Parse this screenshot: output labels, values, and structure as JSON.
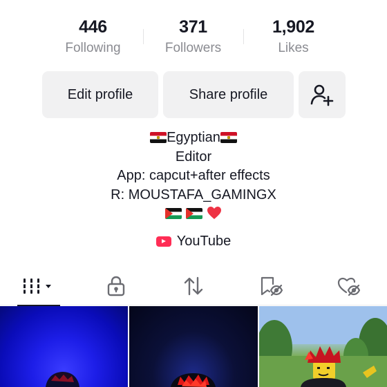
{
  "stats": [
    {
      "value": "446",
      "label": "Following"
    },
    {
      "value": "371",
      "label": "Followers"
    },
    {
      "value": "1,902",
      "label": "Likes"
    }
  ],
  "actions": {
    "edit_label": "Edit profile",
    "share_label": "Share profile",
    "add_friends_icon": "add-user-icon"
  },
  "bio": {
    "line1_text": "Egyptian",
    "line1_flags": [
      "egypt-flag",
      "egypt-flag"
    ],
    "line2": "Editor",
    "line3": "App: capcut+after effects",
    "line4": "R: MOUSTAFA_GAMINGX",
    "line5_emojis": [
      "palestine-flag",
      "palestine-flag",
      "red-heart"
    ]
  },
  "link": {
    "label": "YouTube",
    "icon": "youtube-icon"
  },
  "tabs": [
    {
      "icon": "videos-grid-icon",
      "active": true
    },
    {
      "icon": "lock-icon",
      "active": false
    },
    {
      "icon": "repost-icon",
      "active": false
    },
    {
      "icon": "bookmark-hidden-icon",
      "active": false
    },
    {
      "icon": "liked-hidden-icon",
      "active": false
    }
  ],
  "videos": [
    {
      "thumbnail": "avatar-blue-background"
    },
    {
      "thumbnail": "avatar-dark-background"
    },
    {
      "thumbnail": "avatar-outdoor-trees"
    }
  ],
  "colors": {
    "text": "#161823",
    "muted": "#8a8b91",
    "button_bg": "#f1f1f2",
    "youtube_red": "#ff2d55",
    "heart": "#ee3344"
  }
}
